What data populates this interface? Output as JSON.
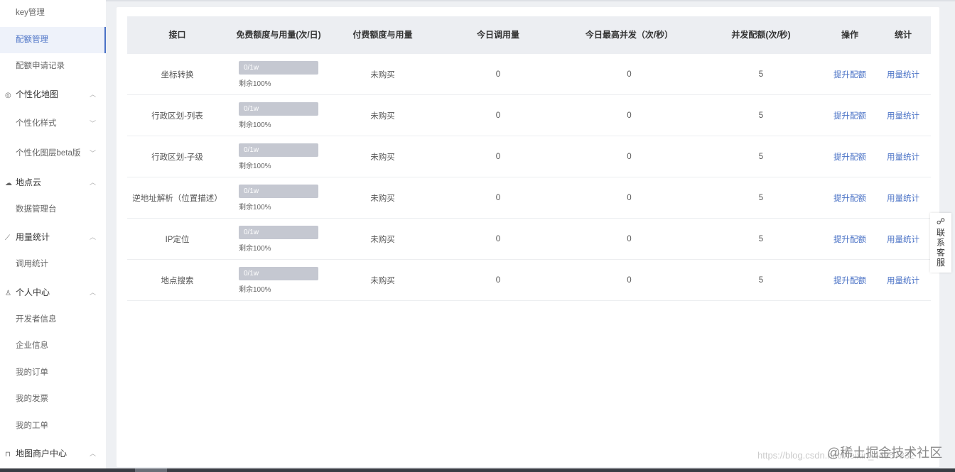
{
  "sidebar": {
    "items": [
      {
        "label": "key管理",
        "kind": "sub",
        "active": false
      },
      {
        "label": "配额管理",
        "kind": "sub",
        "active": true
      },
      {
        "label": "配额申请记录",
        "kind": "sub",
        "active": false
      },
      {
        "label": "个性化地图",
        "kind": "group",
        "icon": "map-icon",
        "chevron": "up"
      },
      {
        "label": "个性化样式",
        "kind": "sub",
        "chevron": "down",
        "tall": true
      },
      {
        "label": "个性化图层beta版",
        "kind": "sub",
        "chevron": "down",
        "tall": true
      },
      {
        "label": "地点云",
        "kind": "group",
        "icon": "cloud-icon",
        "chevron": "up"
      },
      {
        "label": "数据管理台",
        "kind": "sub"
      },
      {
        "label": "用量统计",
        "kind": "group",
        "icon": "chart-icon",
        "chevron": "up"
      },
      {
        "label": "调用统计",
        "kind": "sub"
      },
      {
        "label": "个人中心",
        "kind": "group",
        "icon": "user-icon",
        "chevron": "up"
      },
      {
        "label": "开发者信息",
        "kind": "sub"
      },
      {
        "label": "企业信息",
        "kind": "sub"
      },
      {
        "label": "我的订单",
        "kind": "sub"
      },
      {
        "label": "我的发票",
        "kind": "sub"
      },
      {
        "label": "我的工单",
        "kind": "sub"
      },
      {
        "label": "地图商户中心",
        "kind": "group",
        "icon": "cart-icon",
        "chevron": "up"
      }
    ]
  },
  "table": {
    "headers": [
      "接口",
      "免费额度与用量(次/日)",
      "付费额度与用量",
      "今日调用量",
      "今日最高并发（次/秒）",
      "并发配额(次/秒)",
      "操作",
      "统计"
    ],
    "rows": [
      {
        "api": "坐标转换",
        "quota_text": "0/1w",
        "used_fraction": 0,
        "remain": "剩余100%",
        "paid": "未购买",
        "today_calls": "0",
        "peak": "0",
        "concurrency": "5",
        "action": "提升配额",
        "stats": "用量统计"
      },
      {
        "api": "行政区划-列表",
        "quota_text": "0/1w",
        "used_fraction": 0,
        "remain": "剩余100%",
        "paid": "未购买",
        "today_calls": "0",
        "peak": "0",
        "concurrency": "5",
        "action": "提升配额",
        "stats": "用量统计"
      },
      {
        "api": "行政区划-子级",
        "quota_text": "0/1w",
        "used_fraction": 0,
        "remain": "剩余100%",
        "paid": "未购买",
        "today_calls": "0",
        "peak": "0",
        "concurrency": "5",
        "action": "提升配额",
        "stats": "用量统计"
      },
      {
        "api": "逆地址解析（位置描述）",
        "quota_text": "0/1w",
        "used_fraction": 0,
        "remain": "剩余100%",
        "paid": "未购买",
        "today_calls": "0",
        "peak": "0",
        "concurrency": "5",
        "action": "提升配额",
        "stats": "用量统计"
      },
      {
        "api": "IP定位",
        "quota_text": "0/1w",
        "used_fraction": 0,
        "remain": "剩余100%",
        "paid": "未购买",
        "today_calls": "0",
        "peak": "0",
        "concurrency": "5",
        "action": "提升配额",
        "stats": "用量统计"
      },
      {
        "api": "地点搜索",
        "quota_text": "0/1w",
        "used_fraction": 0,
        "remain": "剩余100%",
        "paid": "未购买",
        "today_calls": "0",
        "peak": "0",
        "concurrency": "5",
        "action": "提升配额",
        "stats": "用量统计"
      }
    ]
  },
  "contact": {
    "label": "联系客服"
  },
  "watermark": {
    "url": "https://blog.csdn.net/weixin_44957332",
    "brand": "@稀土掘金技术社区"
  }
}
